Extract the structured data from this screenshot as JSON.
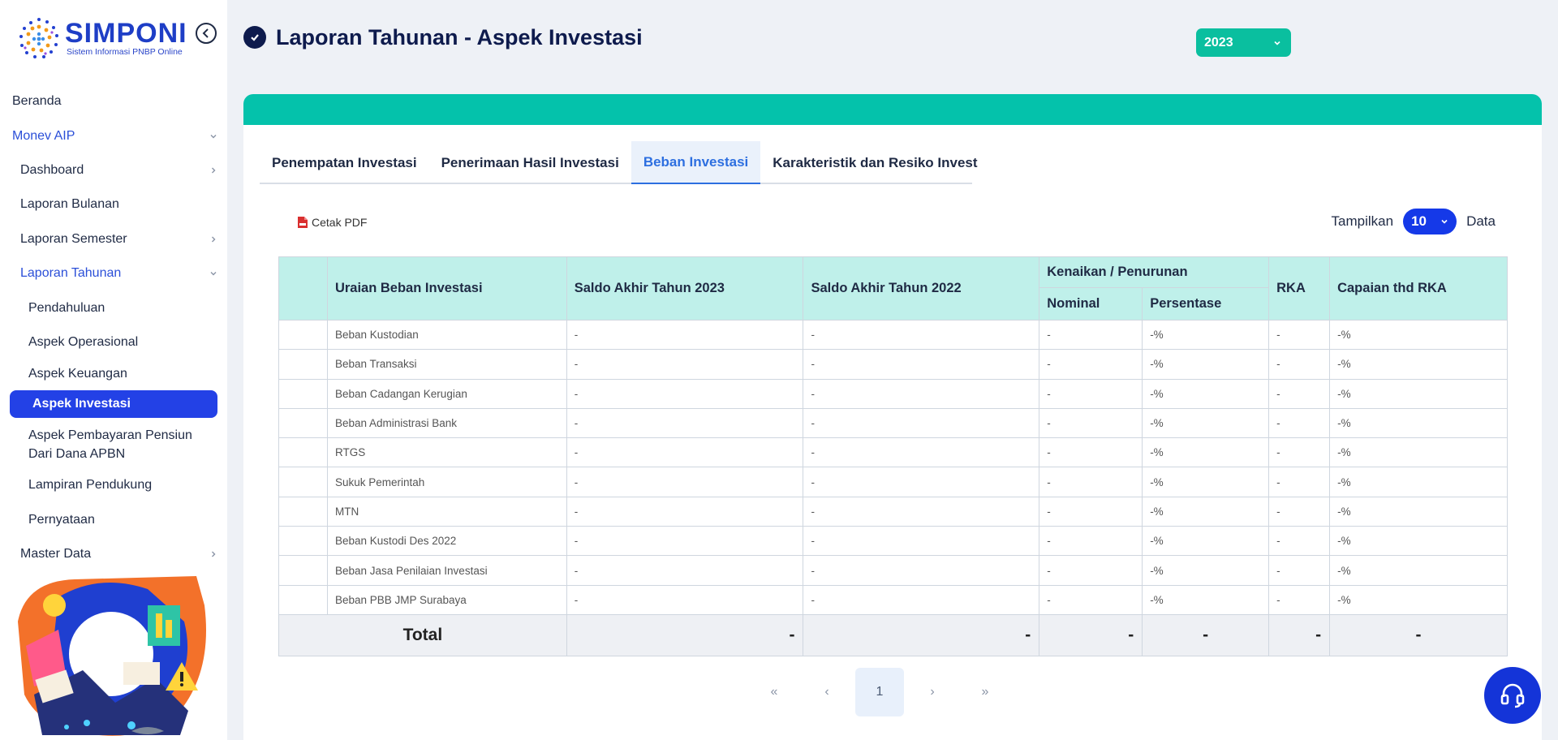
{
  "brand": {
    "name": "SIMPONI",
    "tagline": "Sistem Informasi PNBP Online"
  },
  "sidebar": {
    "items": [
      {
        "label": "Beranda"
      },
      {
        "label": "Monev AIP"
      },
      {
        "label": "Dashboard"
      },
      {
        "label": "Laporan Bulanan"
      },
      {
        "label": "Laporan Semester"
      },
      {
        "label": "Laporan Tahunan"
      },
      {
        "label": "Pendahuluan"
      },
      {
        "label": "Aspek Operasional"
      },
      {
        "label": "Aspek Keuangan"
      },
      {
        "label": "Aspek Investasi"
      },
      {
        "label": "Aspek Pembayaran Pensiun Dari Dana APBN"
      },
      {
        "label": "Lampiran Pendukung"
      },
      {
        "label": "Pernyataan"
      },
      {
        "label": "Master Data"
      }
    ]
  },
  "header": {
    "title": "Laporan Tahunan - Aspek Investasi",
    "year": "2023"
  },
  "tabs": [
    {
      "label": "Penempatan Investasi"
    },
    {
      "label": "Penerimaan Hasil Investasi"
    },
    {
      "label": "Beban Investasi"
    },
    {
      "label": "Karakteristik dan Resiko Invest"
    }
  ],
  "toolbar": {
    "print_label": "Cetak PDF",
    "show_prefix": "Tampilkan",
    "show_value": "10",
    "show_suffix": "Data"
  },
  "table": {
    "headers": {
      "uraian": "Uraian Beban Investasi",
      "saldo_2023": "Saldo Akhir Tahun 2023",
      "saldo_2022": "Saldo Akhir Tahun 2022",
      "kenaikan": "Kenaikan / Penurunan",
      "nominal": "Nominal",
      "persentase": "Persentase",
      "rka": "RKA",
      "capaian": "Capaian thd RKA"
    },
    "rows": [
      {
        "uraian": "Beban Kustodian",
        "saldo_2023": "-",
        "saldo_2022": "-",
        "nominal": "-",
        "persentase": "-%",
        "rka": "-",
        "capaian": "-%"
      },
      {
        "uraian": "Beban Transaksi",
        "saldo_2023": "-",
        "saldo_2022": "-",
        "nominal": "-",
        "persentase": "-%",
        "rka": "-",
        "capaian": "-%"
      },
      {
        "uraian": "Beban Cadangan Kerugian",
        "saldo_2023": "-",
        "saldo_2022": "-",
        "nominal": "-",
        "persentase": "-%",
        "rka": "-",
        "capaian": "-%"
      },
      {
        "uraian": "Beban Administrasi Bank",
        "saldo_2023": "-",
        "saldo_2022": "-",
        "nominal": "-",
        "persentase": "-%",
        "rka": "-",
        "capaian": "-%"
      },
      {
        "uraian": "RTGS",
        "saldo_2023": "-",
        "saldo_2022": "-",
        "nominal": "-",
        "persentase": "-%",
        "rka": "-",
        "capaian": "-%"
      },
      {
        "uraian": "Sukuk Pemerintah",
        "saldo_2023": "-",
        "saldo_2022": "-",
        "nominal": "-",
        "persentase": "-%",
        "rka": "-",
        "capaian": "-%"
      },
      {
        "uraian": "MTN",
        "saldo_2023": "-",
        "saldo_2022": "-",
        "nominal": "-",
        "persentase": "-%",
        "rka": "-",
        "capaian": "-%"
      },
      {
        "uraian": "Beban Kustodi Des 2022",
        "saldo_2023": "-",
        "saldo_2022": "-",
        "nominal": "-",
        "persentase": "-%",
        "rka": "-",
        "capaian": "-%"
      },
      {
        "uraian": "Beban Jasa Penilaian Investasi",
        "saldo_2023": "-",
        "saldo_2022": "-",
        "nominal": "-",
        "persentase": "-%",
        "rka": "-",
        "capaian": "-%"
      },
      {
        "uraian": "Beban PBB JMP Surabaya",
        "saldo_2023": "-",
        "saldo_2022": "-",
        "nominal": "-",
        "persentase": "-%",
        "rka": "-",
        "capaian": "-%"
      }
    ],
    "total": {
      "label": "Total",
      "saldo_2023": "-",
      "saldo_2022": "-",
      "nominal": "-",
      "persentase": "-",
      "rka": "-",
      "capaian": "-"
    }
  },
  "pagination": {
    "first": "«",
    "prev": "‹",
    "current": "1",
    "next": "›",
    "last": "»"
  },
  "icons": {
    "collapse": "chevron-left-circle-icon",
    "title": "check-circle-icon",
    "pdf": "pdf-file-icon",
    "help": "headset-icon"
  },
  "colors": {
    "accent_teal": "#04c2ab",
    "primary_blue": "#2341e6",
    "header_cell": "#bff0ea",
    "tab_active": "#2d6fe0"
  }
}
